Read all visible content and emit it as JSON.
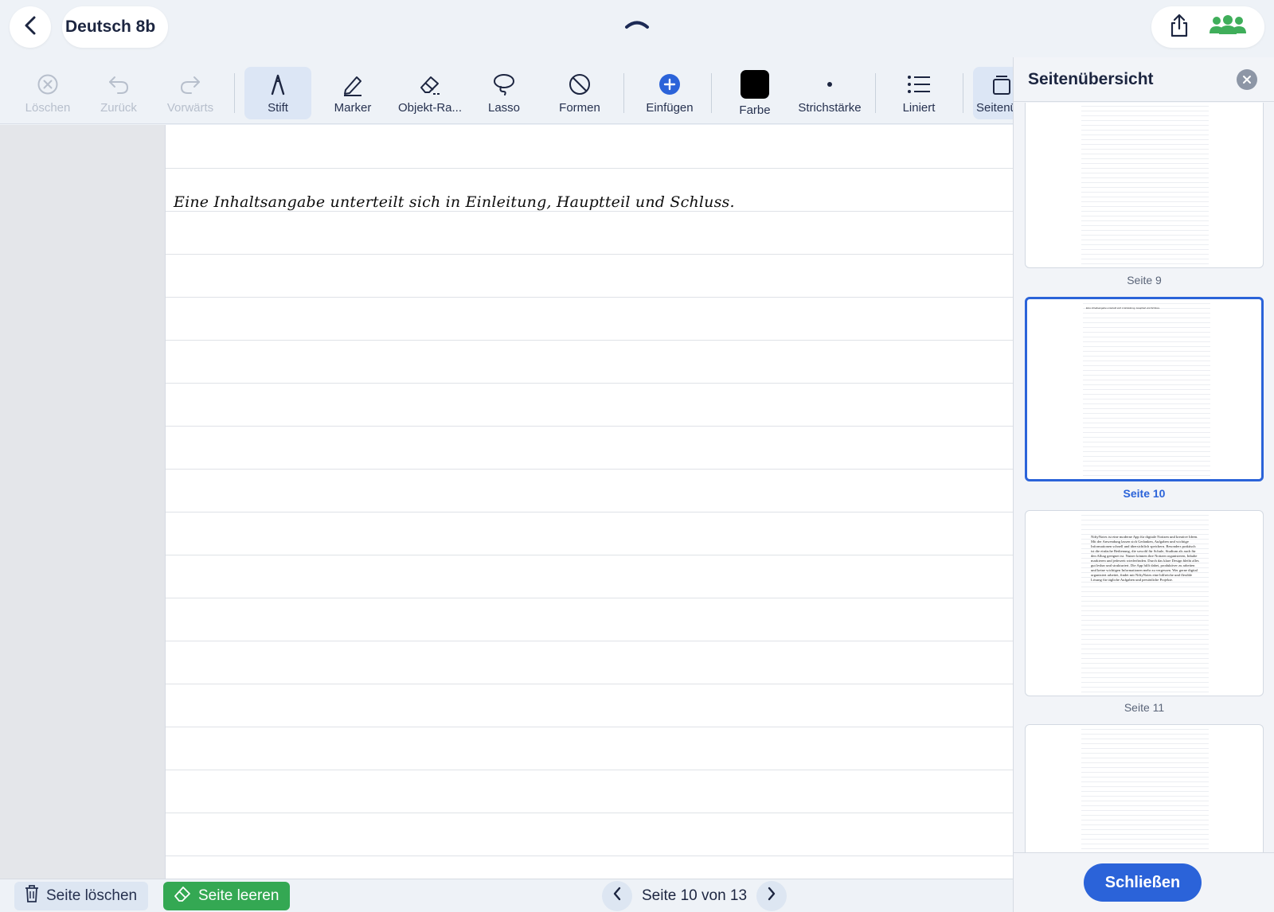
{
  "header": {
    "notebook_title": "Deutsch 8b"
  },
  "toolbar": {
    "delete_label": "Löschen",
    "undo_label": "Zurück",
    "redo_label": "Vorwärts",
    "pen_label": "Stift",
    "marker_label": "Marker",
    "eraser_label": "Objekt-Ra...",
    "lasso_label": "Lasso",
    "shapes_label": "Formen",
    "insert_label": "Einfügen",
    "color_label": "Farbe",
    "stroke_label": "Strichstärke",
    "lined_label": "Liniert",
    "pages_label": "Seitenü",
    "current_color": "#000000"
  },
  "page": {
    "handwritten_text": "Eine Inhaltsangabe unterteilt sich in Einleitung, Hauptteil und Schluss."
  },
  "bottombar": {
    "delete_page_label": "Seite löschen",
    "clear_page_label": "Seite leeren",
    "page_indicator": "Seite 10 von 13"
  },
  "panel": {
    "title": "Seitenübersicht",
    "thumbnails": [
      {
        "label": "Seite 9",
        "selected": false
      },
      {
        "label": "Seite 10",
        "selected": true
      },
      {
        "label": "Seite 11",
        "selected": false
      }
    ],
    "page11_text": "NiftyNotes ist eine moderne App für digitale Notizen und kreative Ideen. Mit der Anwendung lassen sich Gedanken, Aufgaben und wichtige Informationen schnell und übersichtlich speichern. Besonders praktisch ist die einfache Bedienung, die sowohl für Schule, Studium als auch für den Alltag geeignet ist. Nutzer können ihre Notizen organisieren, Inhalte markieren und jederzeit wiederfinden. Durch das klare Design bleibt alles gut lesbar und strukturiert. Die App hilft dabei, produktiver zu arbeiten und keine wichtigen Informationen mehr zu vergessen. Wer gerne digital organisiert arbeitet, findet mit NiftyNotes eine hilfreiche und flexible Lösung für tägliche Aufgaben und persönliche Projekte.",
    "close_label": "Schließen"
  },
  "colors": {
    "accent": "#2b63d9",
    "clear_green": "#34a853",
    "collab_green": "#3fae5a"
  }
}
